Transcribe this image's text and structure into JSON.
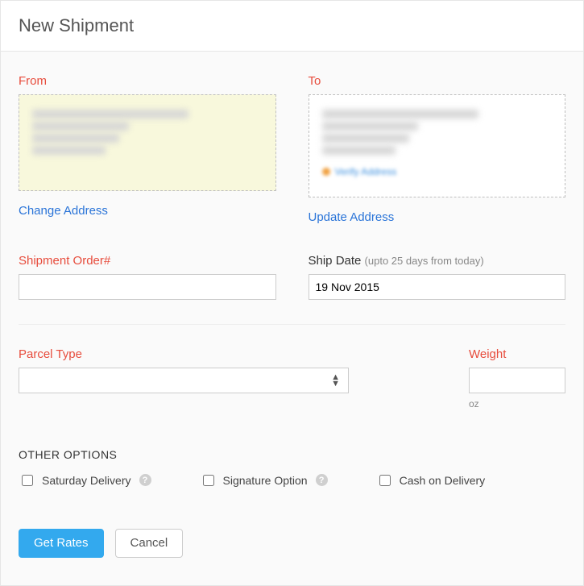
{
  "header": {
    "title": "New Shipment"
  },
  "from": {
    "label": "From",
    "action": "Change Address"
  },
  "to": {
    "label": "To",
    "action": "Update Address",
    "verify_label": "Verify Address"
  },
  "fields": {
    "shipment_order_label": "Shipment Order#",
    "shipment_order_value": "",
    "ship_date_label": "Ship Date",
    "ship_date_hint": "(upto 25 days from today)",
    "ship_date_value": "19 Nov 2015",
    "parcel_type_label": "Parcel Type",
    "parcel_type_value": "",
    "weight_label": "Weight",
    "weight_value": "",
    "weight_unit": "oz"
  },
  "other_options": {
    "heading": "OTHER OPTIONS",
    "items": [
      {
        "label": "Saturday Delivery",
        "checked": false,
        "help": true
      },
      {
        "label": "Signature Option",
        "checked": false,
        "help": true
      },
      {
        "label": "Cash on Delivery",
        "checked": false,
        "help": false
      }
    ]
  },
  "actions": {
    "primary": "Get Rates",
    "secondary": "Cancel"
  }
}
